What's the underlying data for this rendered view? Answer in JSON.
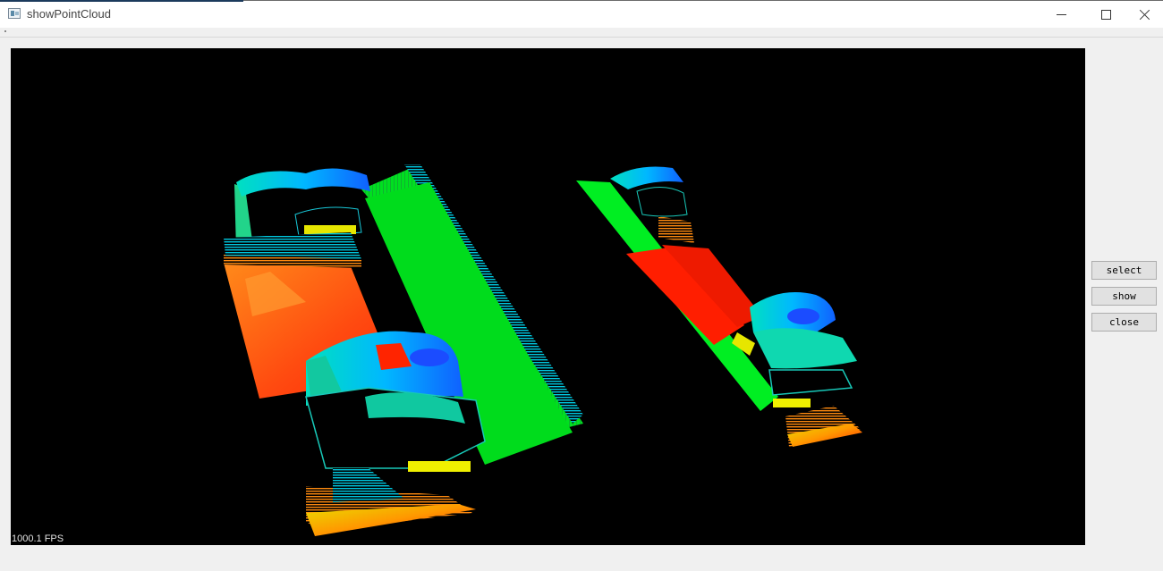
{
  "window": {
    "title": "showPointCloud",
    "controls": [
      "minimize",
      "maximize",
      "close"
    ]
  },
  "viewer": {
    "fps_label": "1000.1 FPS",
    "icons": {
      "point_cloud": "point-cloud-render"
    }
  },
  "buttons": {
    "select_label": "select",
    "show_label": "show",
    "close_label": "close"
  },
  "colors": {
    "window_bg": "#f0f0f0",
    "viewport_bg": "#000000"
  }
}
